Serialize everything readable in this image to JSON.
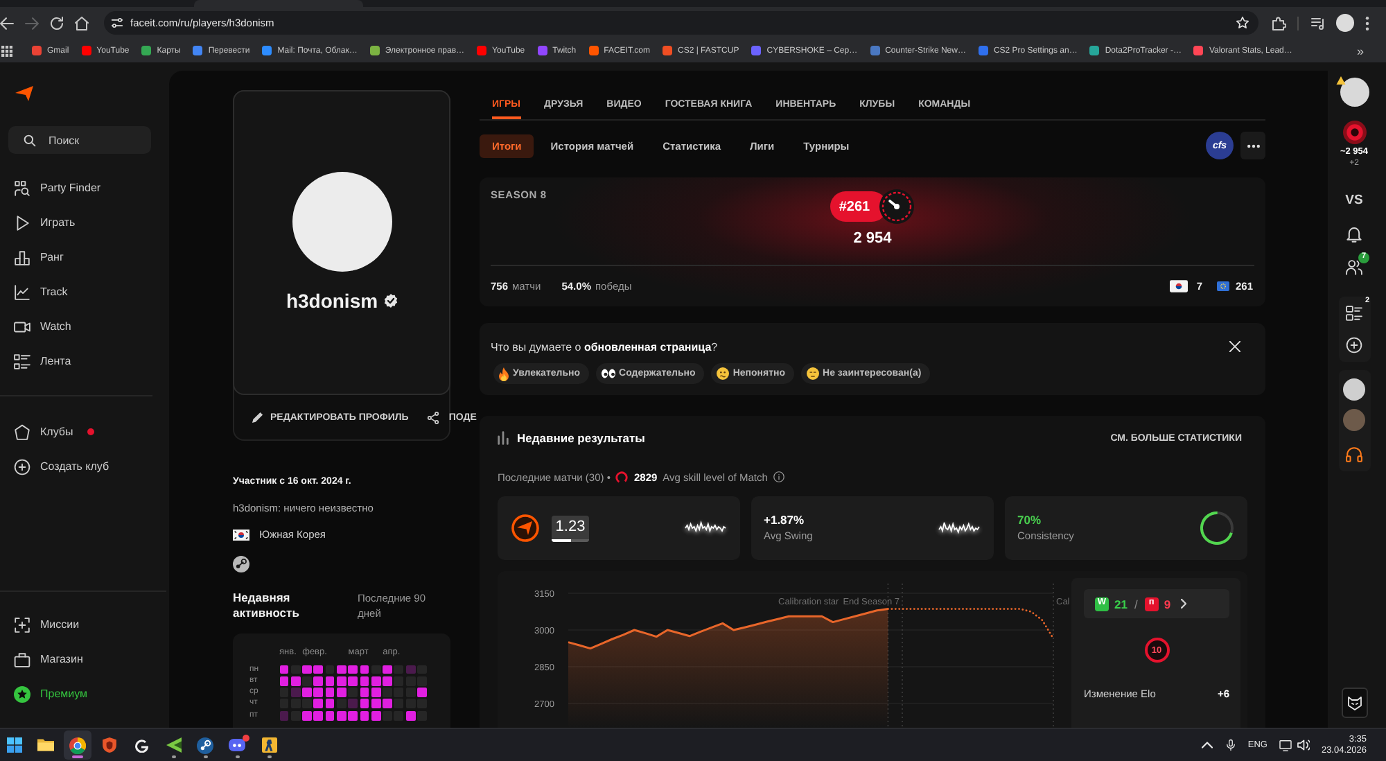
{
  "browser": {
    "url": "faceit.com/ru/players/h3donism",
    "forward_disabled": true,
    "bookmarks": [
      {
        "label": "Gmail",
        "color": "#ea4335"
      },
      {
        "label": "YouTube",
        "color": "#ff0000"
      },
      {
        "label": "Карты",
        "color": "#34a853"
      },
      {
        "label": "Перевести",
        "color": "#4285f4"
      },
      {
        "label": "Mail: Почта, Облак…",
        "color": "#2d8cff"
      },
      {
        "label": "Электронное прав…",
        "color": "#7cb342"
      },
      {
        "label": "YouTube",
        "color": "#ff0000"
      },
      {
        "label": "Twitch",
        "color": "#9146ff"
      },
      {
        "label": "FACEIT.com",
        "color": "#ff5500"
      },
      {
        "label": "CS2 | FASTCUP",
        "color": "#f04e23"
      },
      {
        "label": "CYBERSHOKE – Сер…",
        "color": "#6c63ff"
      },
      {
        "label": "Counter-Strike New…",
        "color": "#4a78c2"
      },
      {
        "label": "CS2 Pro Settings an…",
        "color": "#2f6fed"
      },
      {
        "label": "Dota2ProTracker -…",
        "color": "#26a69a"
      },
      {
        "label": "Valorant Stats, Lead…",
        "color": "#ff4655"
      }
    ],
    "more": "»"
  },
  "sidebar": {
    "search": {
      "placeholder": "Поиск"
    },
    "items": [
      {
        "label": "Party Finder"
      },
      {
        "label": "Играть"
      },
      {
        "label": "Ранг"
      },
      {
        "label": "Track"
      },
      {
        "label": "Watch"
      },
      {
        "label": "Лента"
      }
    ],
    "clubs": [
      {
        "label": "Клубы",
        "notification": true
      },
      {
        "label": "Создать клуб",
        "notification": false
      }
    ],
    "bottom": [
      {
        "label": "Миссии",
        "highlighted": false
      },
      {
        "label": "Магазин",
        "highlighted": false
      },
      {
        "label": "Премиум",
        "highlighted": true
      }
    ]
  },
  "profile": {
    "name": "h3donism",
    "verified": true,
    "actions": [
      "РЕДАКТИРОВАТЬ ПРОФИЛЬ",
      "ПОДЕ"
    ],
    "member_since": "Участник с 16 окт. 2024 г.",
    "bio": "h3donism: ничего неизвестно",
    "country": "Южная Корея",
    "activity": {
      "title": "Недавняя активность",
      "period": "Последние 90 дней",
      "months": [
        "янв.",
        "февр.",
        "март",
        "апр."
      ],
      "rows": [
        {
          "day": "пн",
          "cells": [
            {
              "color": "#e11fe1"
            },
            {
              "color": "#262626"
            },
            {
              "color": "#e11fe1"
            },
            {
              "color": "#e11fe1"
            },
            {
              "color": "#262626"
            },
            {
              "color": "#e11fe1"
            },
            {
              "color": "#e11fe1"
            },
            {
              "color": "#e11fe1"
            },
            {
              "color": "#262626"
            },
            {
              "color": "#e11fe1"
            },
            {
              "color": "#262626"
            },
            {
              "color": "#4b1a4d"
            },
            {
              "color": "#262626"
            }
          ]
        },
        {
          "day": "вт",
          "cells": [
            {
              "color": "#e11fe1"
            },
            {
              "color": "#e11fe1"
            },
            {
              "color": "#262626"
            },
            {
              "color": "#e11fe1"
            },
            {
              "color": "#e11fe1"
            },
            {
              "color": "#e11fe1"
            },
            {
              "color": "#e11fe1"
            },
            {
              "color": "#e11fe1"
            },
            {
              "color": "#e11fe1"
            },
            {
              "color": "#e11fe1"
            },
            {
              "color": "#262626"
            },
            {
              "color": "#262626"
            },
            {
              "color": "#262626"
            }
          ]
        },
        {
          "day": "ср",
          "cells": [
            {
              "color": "#262626"
            },
            {
              "color": "#4b1a4d"
            },
            {
              "color": "#e11fe1"
            },
            {
              "color": "#e11fe1"
            },
            {
              "color": "#e11fe1"
            },
            {
              "color": "#e11fe1"
            },
            {
              "color": "#262626"
            },
            {
              "color": "#e11fe1"
            },
            {
              "color": "#e11fe1"
            },
            {
              "color": "#262626"
            },
            {
              "color": "#262626"
            },
            {
              "color": "#262626"
            },
            {
              "color": "#e11fe1"
            }
          ]
        },
        {
          "day": "чт",
          "cells": [
            {
              "color": "#262626"
            },
            {
              "color": "#262626"
            },
            {
              "color": "#262626"
            },
            {
              "color": "#e11fe1"
            },
            {
              "color": "#e11fe1"
            },
            {
              "color": "#262626"
            },
            {
              "color": "#4b1a4d"
            },
            {
              "color": "#e11fe1"
            },
            {
              "color": "#e11fe1"
            },
            {
              "color": "#e11fe1"
            },
            {
              "color": "#262626"
            },
            {
              "color": "#262626"
            },
            {
              "color": "#262626"
            }
          ]
        },
        {
          "day": "пт",
          "cells": [
            {
              "color": "#4b1a4d"
            },
            {
              "color": "#262626"
            },
            {
              "color": "#e11fe1"
            },
            {
              "color": "#e11fe1"
            },
            {
              "color": "#e11fe1"
            },
            {
              "color": "#e11fe1"
            },
            {
              "color": "#e11fe1"
            },
            {
              "color": "#e11fe1"
            },
            {
              "color": "#e11fe1"
            },
            {
              "color": "#262626"
            },
            {
              "color": "#262626"
            },
            {
              "color": "#e11fe1"
            },
            {
              "color": "#262626"
            }
          ]
        }
      ]
    }
  },
  "games": {
    "tabs": [
      {
        "label": "ИГРЫ",
        "selected": true
      },
      {
        "label": "ДРУЗЬЯ",
        "selected": false
      },
      {
        "label": "ВИДЕО",
        "selected": false
      },
      {
        "label": "ГОСТЕВАЯ КНИГА",
        "selected": false
      },
      {
        "label": "ИНВЕНТАРЬ",
        "selected": false
      },
      {
        "label": "КЛУБЫ",
        "selected": false
      },
      {
        "label": "КОМАНДЫ",
        "selected": false
      }
    ],
    "subtabs": [
      {
        "label": "Итоги",
        "selected": true
      },
      {
        "label": "История матчей",
        "selected": false
      },
      {
        "label": "Статистика",
        "selected": false
      },
      {
        "label": "Лиги",
        "selected": false
      },
      {
        "label": "Турниры",
        "selected": false
      }
    ],
    "team_logo": "cfs",
    "season": {
      "title": "SEASON 8",
      "rank": "#261",
      "elo": "2 954",
      "stats": [
        {
          "value": "756",
          "label": "матчи"
        },
        {
          "value": "54.0%",
          "label": "победы"
        }
      ],
      "country_rank": "7",
      "region_rank": "261"
    },
    "feedback": {
      "question": "Что вы думаете о **обновленная страница**?",
      "options": [
        "Увлекательно",
        "Содержательно",
        "Непонятно",
        "Не заинтересован(а)"
      ]
    },
    "recent": {
      "title": "Недавние результаты",
      "more_link": "СМ. БОЛЬШЕ СТАТИСТИКИ",
      "summary": "Последние матчи (30) •",
      "avg_skill": "2829",
      "avg_skill_label": "Avg skill level of Match",
      "cards": [
        {
          "kind": "rating",
          "value": "1.23",
          "level": 0.5
        },
        {
          "kind": "swing",
          "value": "+1.87%",
          "label": "Avg Swing"
        },
        {
          "kind": "consistency",
          "value": "70%",
          "label": "Consistency",
          "level": 0.7
        }
      ],
      "chart_data": {
        "type": "line",
        "categories": [
          null,
          null,
          null,
          null,
          null,
          null,
          null,
          null,
          null,
          null,
          null,
          null,
          null,
          null,
          null,
          null,
          null,
          null,
          null,
          null,
          null,
          null,
          null,
          null,
          null,
          null,
          null,
          null,
          null,
          null,
          null,
          null,
          null,
          null,
          null,
          null,
          null,
          null,
          null,
          null,
          null,
          null,
          null,
          null,
          null
        ],
        "ylim": [
          2700,
          3150
        ],
        "yticks": [
          2700,
          2850,
          3000,
          3150
        ],
        "series": [
          {
            "color": "#e8662a",
            "line_style": "solid",
            "values": [
              2950,
              2938,
              2925,
              2944,
              2963,
              2981,
              3000,
              2987,
              2973,
              3000,
              2988,
              2975,
              2993,
              3010,
              3027,
              3000,
              3011,
              3022,
              3034,
              3045,
              3056,
              3056,
              3056,
              3056,
              3032,
              3044,
              3056,
              3068,
              3080,
              3086,
              null,
              null,
              null,
              null,
              null,
              null,
              null,
              null,
              null,
              null,
              null,
              null,
              null,
              null,
              null
            ]
          },
          {
            "color": "#e8662a",
            "line_style": "dotted",
            "values": [
              null,
              null,
              null,
              null,
              null,
              null,
              null,
              null,
              null,
              null,
              null,
              null,
              null,
              null,
              null,
              null,
              null,
              null,
              null,
              null,
              null,
              null,
              null,
              null,
              null,
              null,
              null,
              null,
              null,
              3086,
              3086,
              3086,
              3086,
              3086,
              3086,
              3086,
              3086,
              3086,
              3086,
              3086,
              3086,
              3086,
              3075,
              3040,
              2965
            ]
          }
        ],
        "annotations": [
          {
            "text": "Calibration star"
          },
          {
            "text": "End Season 7"
          },
          {
            "text": "Cal"
          }
        ]
      },
      "record": {
        "win_mark": "W",
        "wins": "21",
        "separator": "/",
        "loss_mark": "п",
        "losses": "9"
      },
      "skill_level": "10",
      "elo_change": {
        "label": "Изменение Elo",
        "value": "+6"
      }
    }
  },
  "rail": {
    "elo": "~2 954",
    "elo_change": "+2",
    "vs": "VS",
    "friends_count": "7",
    "party_count": "2"
  },
  "taskbar": {
    "apps": [
      {
        "running": false,
        "active": false,
        "notification": false
      },
      {
        "running": false,
        "active": false,
        "notification": false
      },
      {
        "running": true,
        "active": true,
        "notification": false
      },
      {
        "running": false,
        "active": false,
        "notification": false
      },
      {
        "running": false,
        "active": false,
        "notification": false
      },
      {
        "running": true,
        "active": false,
        "notification": false
      },
      {
        "running": true,
        "active": false,
        "notification": false
      },
      {
        "running": true,
        "active": false,
        "notification": true
      },
      {
        "running": true,
        "active": false,
        "notification": false
      }
    ],
    "language": "ENG",
    "time": "3:35",
    "date": "23.04.2026"
  }
}
